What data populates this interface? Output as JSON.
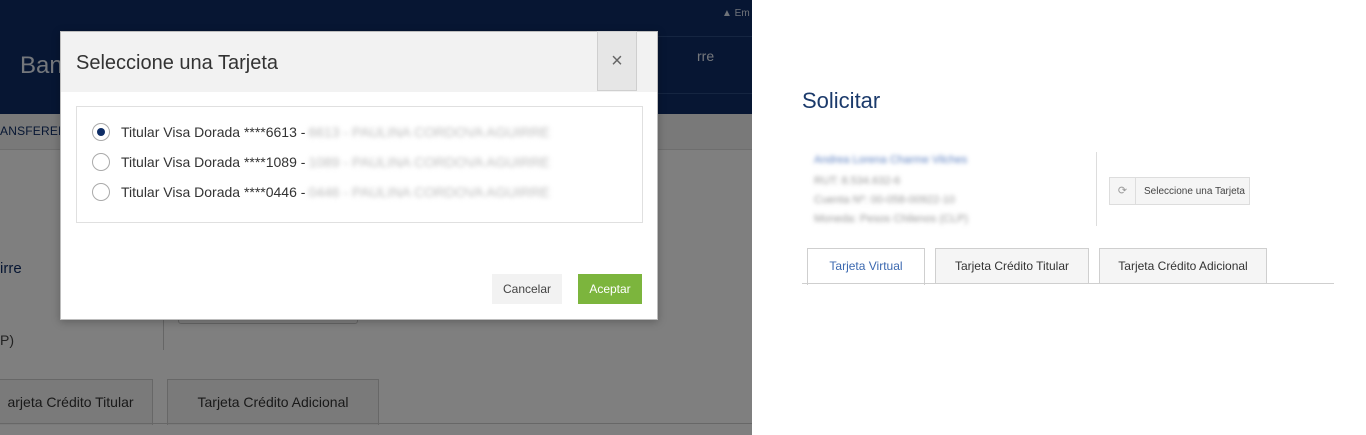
{
  "background_page": {
    "alert_text": "▲ Em",
    "bank_name": "Banc",
    "user_name_fragment": "rre",
    "nav_item": "ANSFEREN",
    "person_fragment": "irre",
    "currency_fragment": "P)",
    "tabs": [
      "arjeta Crédito Titular",
      "Tarjeta Crédito Adicional"
    ]
  },
  "modal": {
    "title": "Seleccione una Tarjeta",
    "close_icon": "×",
    "options": [
      {
        "label": "Titular Visa Dorada ****6613 -",
        "blurred": "6613 - PAULINA CORDOVA AGUIRRE",
        "checked": true
      },
      {
        "label": "Titular Visa Dorada ****1089 -",
        "blurred": "1089 - PAULINA CORDOVA AGUIRRE",
        "checked": false
      },
      {
        "label": "Titular Visa Dorada ****0446 -",
        "blurred": "0446 - PAULINA CORDOVA AGUIRRE",
        "checked": false
      }
    ],
    "cancel_label": "Cancelar",
    "accept_label": "Aceptar",
    "accept_color": "#7cb53d"
  },
  "right_panel": {
    "title": "Solicitar",
    "account": {
      "name": "Andrea Lorena Charme Vilches",
      "rut": "RUT: 8.534.632-6",
      "cuenta": "Cuenta Nº: 00-058-00922-10",
      "moneda": "Moneda: Pesos Chilenos (CLP)"
    },
    "select_card_icon": "⟳",
    "select_card_label": "Seleccione una Tarjeta",
    "tabs": [
      {
        "label": "Tarjeta Virtual",
        "active": true
      },
      {
        "label": "Tarjeta Crédito Titular",
        "active": false
      },
      {
        "label": "Tarjeta Crédito Adicional",
        "active": false
      }
    ]
  },
  "colors": {
    "header_navy": "#0e2d66",
    "accent_blue": "#3c69b0",
    "accept_green": "#7cb53d"
  }
}
